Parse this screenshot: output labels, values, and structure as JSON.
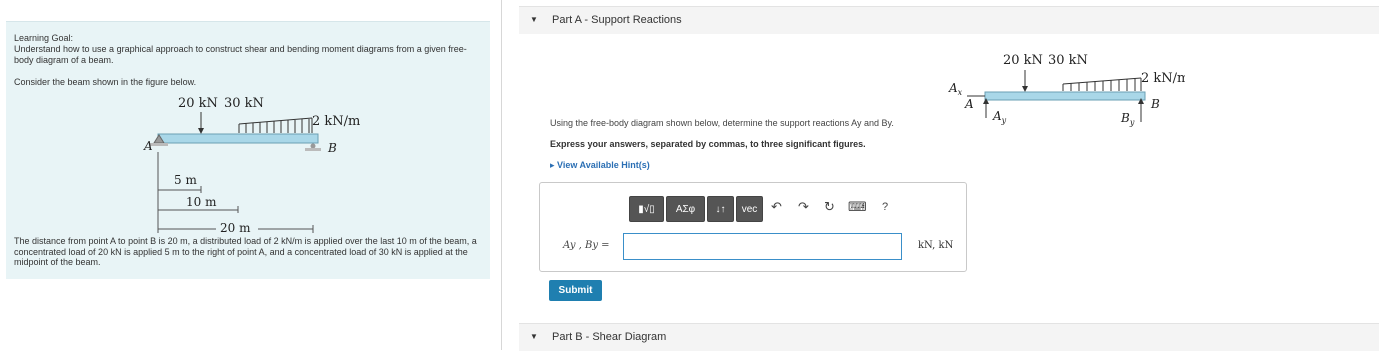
{
  "left": {
    "goal_heading": "Learning Goal:",
    "goal_text": "Understand how to use a graphical approach to construct shear and bending moment diagrams from a given free-body diagram of a beam.",
    "consider": "Consider the beam shown in the figure below.",
    "figure": {
      "load1": "20 kN",
      "load2": "30 kN",
      "dist_load": "2 kN/m",
      "point_a": "A",
      "point_b": "B",
      "dim1": "5 m",
      "dim2": "10 m",
      "dim3": "20 m"
    },
    "description": "The distance from point A to point B is 20 m, a distributed load of 2 kN/m is applied over the last 10 m of the beam, a concentrated load of 20 kN is applied 5 m to the right of point A, and a concentrated load of 30 kN is applied at the midpoint of the beam."
  },
  "part_a": {
    "caret": "▼",
    "title": "Part A - Support Reactions",
    "fbd": {
      "load1": "20 kN",
      "load2": "30 kN",
      "dist_load": "2 kN/m",
      "ax": "A",
      "ax_sub": "x",
      "a": "A",
      "ay": "A",
      "ay_sub": "y",
      "b": "B",
      "by": "B",
      "by_sub": "y"
    },
    "instruction": "Using the free-body diagram shown below, determine the support reactions Ay and By.",
    "express": "Express your answers, separated by commas, to three significant figures.",
    "hints": "▸ View Available Hint(s)",
    "toolbar": {
      "templates": "▮√▯",
      "greek": "ΑΣφ",
      "arrows": "↓↑",
      "vec": "vec",
      "undo": "↶",
      "redo": "↷",
      "reset": "↻",
      "keyboard": "⌨",
      "help": "?"
    },
    "eq_label": "Ay , By =",
    "answer_value": "",
    "units": "kN, kN",
    "submit": "Submit"
  },
  "part_b": {
    "caret": "▼",
    "title": "Part B - Shear Diagram"
  }
}
